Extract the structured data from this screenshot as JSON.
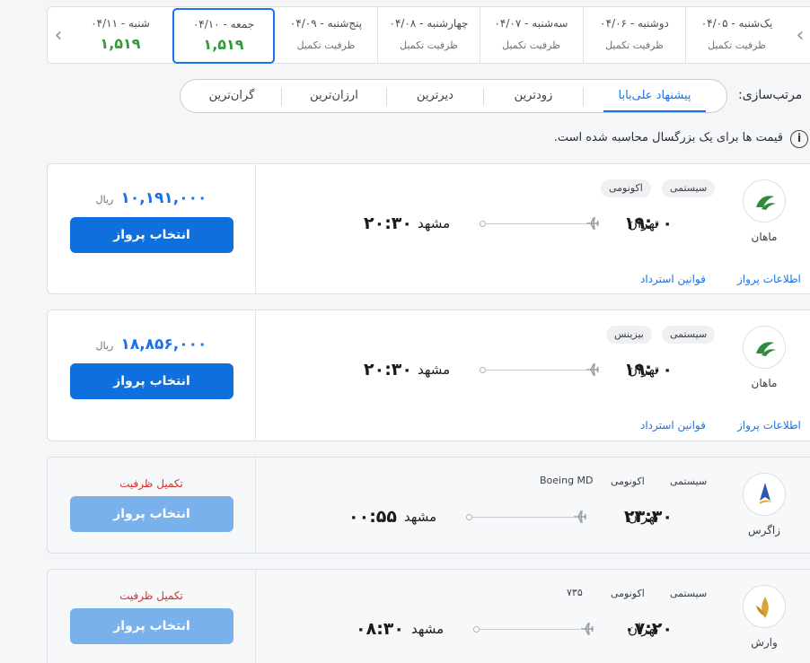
{
  "date_strip": {
    "days": [
      {
        "label": "یک‌شنبه - ۰۴/۰۵",
        "sub": "ظرفیت تکمیل"
      },
      {
        "label": "دوشنبه - ۰۴/۰۶",
        "sub": "ظرفیت تکمیل"
      },
      {
        "label": "سه‌شنبه - ۰۴/۰۷",
        "sub": "ظرفیت تکمیل"
      },
      {
        "label": "چهارشنبه - ۰۴/۰۸",
        "sub": "ظرفیت تکمیل"
      },
      {
        "label": "پنج‌شنبه - ۰۴/۰۹",
        "sub": "ظرفیت تکمیل"
      },
      {
        "label": "جمعه - ۰۴/۱۰",
        "price": "۱,۵۱۹"
      },
      {
        "label": "شنبه - ۰۴/۱۱",
        "price": "۱,۵۱۹"
      }
    ]
  },
  "sort": {
    "label": "مرتب‌سازی:",
    "options": [
      "پیشنهاد علی‌بابا",
      "زودترین",
      "دیرترین",
      "ارزان‌ترین",
      "گران‌ترین"
    ]
  },
  "note": "قیمت ها برای یک بزرگسال محاسبه شده است.",
  "flights": [
    {
      "airline": "ماهان",
      "tags": [
        "سیستمی",
        "اکونومی"
      ],
      "origin": "تهران",
      "dep_time": "۱۹:۰۰",
      "destination": "مشهد",
      "arr_time": "۲۰:۳۰",
      "price": "۱۰,۱۹۱,۰۰۰",
      "currency": "ریال",
      "button": "انتخاب پرواز",
      "link_info": "اطلاعات پرواز",
      "link_refund": "قوانین استرداد"
    },
    {
      "airline": "ماهان",
      "tags": [
        "سیستمی",
        "بیزینس"
      ],
      "origin": "تهران",
      "dep_time": "۱۹:۰۰",
      "destination": "مشهد",
      "arr_time": "۲۰:۳۰",
      "price": "۱۸,۸۵۶,۰۰۰",
      "currency": "ریال",
      "button": "انتخاب پرواز",
      "link_info": "اطلاعات پرواز",
      "link_refund": "قوانین استرداد"
    },
    {
      "airline": "زاگرس",
      "tags": [
        "سیستمی",
        "اکونومی",
        "Boeing MD"
      ],
      "origin": "تهران",
      "dep_time": "۲۳:۳۰",
      "destination": "مشهد",
      "arr_time": "۰۰:۵۵",
      "status": "تکمیل ظرفیت",
      "button": "انتخاب پرواز"
    },
    {
      "airline": "وارش",
      "tags": [
        "سیستمی",
        "اکونومی",
        "۷۳۵"
      ],
      "origin": "تهران",
      "dep_time": "۰۷:۲۰",
      "destination": "مشهد",
      "arr_time": "۰۸:۳۰",
      "status": "تکمیل ظرفیت",
      "button": "انتخاب پرواز"
    }
  ],
  "colors": {
    "accent": "#1a73e8",
    "button": "#0f6fdc",
    "button_disabled": "#79b1ec",
    "price_green": "#2e9c3c",
    "full": "#d32f2f"
  }
}
